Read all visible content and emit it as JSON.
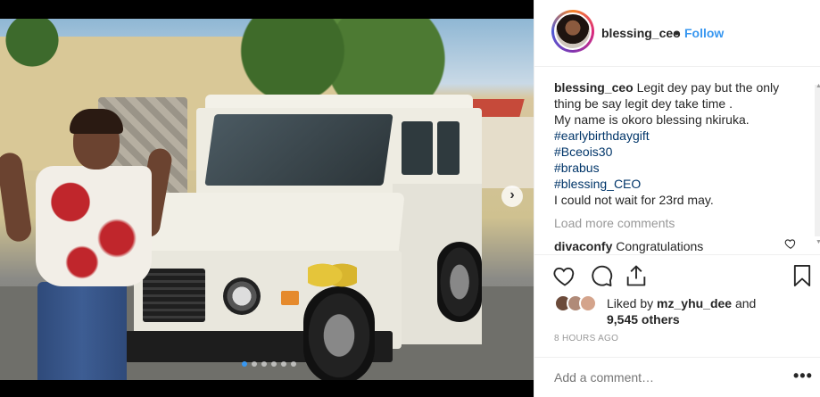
{
  "post": {
    "username": "blessing_ceo",
    "separator": "•",
    "follow_label": "Follow",
    "caption_user": "blessing_ceo",
    "caption_lines": [
      "Legit dey pay but the only",
      "thing be say legit dey take time .",
      "My name is okoro blessing nkiruka."
    ],
    "hashtags": [
      "#earlybirthdaygift",
      "#Bceois30",
      "#brabus",
      "#blessing_CEO"
    ],
    "caption_end": "I could not wait for 23rd may.",
    "load_more": "Load more comments",
    "comment": {
      "user": "divaconfy",
      "text": "Congratulations"
    },
    "likes": {
      "prefix": "Liked by",
      "user": "mz_yhu_dee",
      "middle": "and",
      "count": "9,545 others"
    },
    "time": "8 HOURS AGO",
    "add_comment_placeholder": "Add a comment…",
    "more_icon": "•••",
    "next_arrow": "›"
  },
  "carousel": {
    "total": 6,
    "active": 1
  },
  "colors": {
    "link": "#3897f0",
    "hashtag": "#003569",
    "muted": "#999999"
  }
}
